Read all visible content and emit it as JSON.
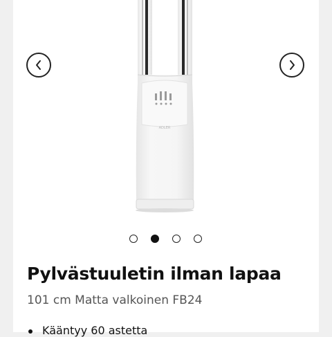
{
  "product": {
    "title": "Pylvästuuletin ilman lapaa",
    "subtitle": "101 cm Matta valkoinen FB24",
    "device_brand_text": "ADLER"
  },
  "gallery": {
    "prev_icon": "chevron-left-icon",
    "next_icon": "chevron-right-icon",
    "slides_count": 4,
    "active_slide": 2
  },
  "features": [
    "Kääntyy 60 astetta"
  ],
  "colors": {
    "page_background": "#f0f0f0",
    "card_background": "#ffffff",
    "device_white": "#f4f4f4",
    "icon_dark": "#222222"
  }
}
